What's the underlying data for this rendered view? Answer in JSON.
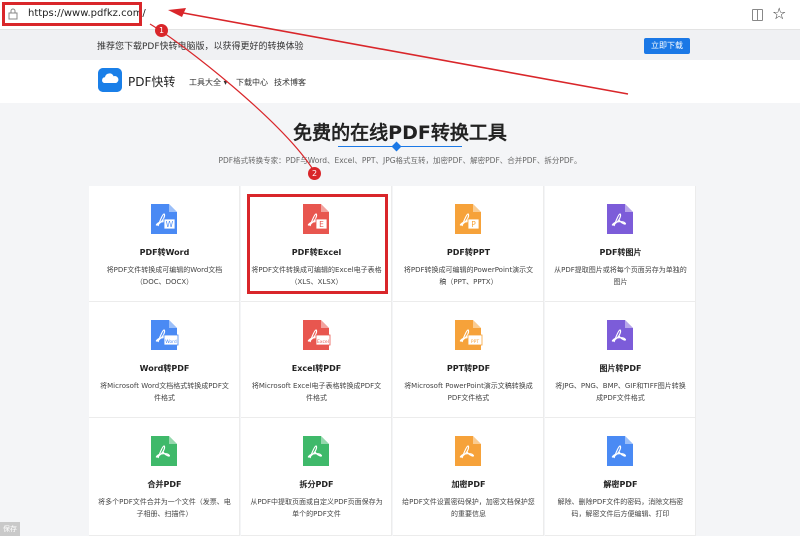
{
  "browser": {
    "url": "https://www.pdfkz.com/"
  },
  "promo": {
    "text": "推荐您下载PDF快转电脑版，以获得更好的转换体验",
    "button": "立即下载"
  },
  "nav": {
    "logo": "PDF快转",
    "items": [
      "工具大全",
      "下载中心",
      "技术博客"
    ]
  },
  "hero": {
    "title": "免费的在线PDF转换工具",
    "subtitle": "PDF格式转换专家：PDF与Word、Excel、PPT、JPG格式互转，加密PDF、解密PDF、合并PDF、拆分PDF。"
  },
  "cards": [
    {
      "title": "PDF转Word",
      "desc": "将PDF文件转换成可编辑的Word文档（DOC、DOCX）",
      "color": "#4a8af4",
      "badge": "W"
    },
    {
      "title": "PDF转Excel",
      "desc": "将PDF文件转换成可编辑的Excel电子表格（XLS、XLSX）",
      "color": "#e8564f",
      "badge": "E"
    },
    {
      "title": "PDF转PPT",
      "desc": "将PDF转换成可编辑的PowerPoint演示文稿（PPT、PPTX）",
      "color": "#f6a23a",
      "badge": "P"
    },
    {
      "title": "PDF转图片",
      "desc": "从PDF提取图片或将每个页面另存为单独的图片",
      "color": "#7c5cd9",
      "badge": ""
    },
    {
      "title": "Word转PDF",
      "desc": "将Microsoft Word文档格式转换成PDF文件格式",
      "color": "#4a8af4",
      "badge": "Word"
    },
    {
      "title": "Excel转PDF",
      "desc": "将Microsoft Excel电子表格转换成PDF文件格式",
      "color": "#e8564f",
      "badge": "Excel"
    },
    {
      "title": "PPT转PDF",
      "desc": "将Microsoft PowerPoint演示文稿转换成PDF文件格式",
      "color": "#f6a23a",
      "badge": "PPT"
    },
    {
      "title": "图片转PDF",
      "desc": "将JPG、PNG、BMP、GIF和TIFF图片转换成PDF文件格式",
      "color": "#7c5cd9",
      "badge": ""
    },
    {
      "title": "合并PDF",
      "desc": "将多个PDF文件合并为一个文件（发票、电子相册、扫描件）",
      "color": "#3fb96a",
      "badge": ""
    },
    {
      "title": "拆分PDF",
      "desc": "从PDF中提取页面或自定义PDF页面保存为单个的PDF文件",
      "color": "#3fb96a",
      "badge": ""
    },
    {
      "title": "加密PDF",
      "desc": "给PDF文件设置密码保护，加密文档保护您的重要信息",
      "color": "#f6a23a",
      "badge": ""
    },
    {
      "title": "解密PDF",
      "desc": "解除、删除PDF文件的密码，消除文档密码，解密文件后方便编辑、打印",
      "color": "#4a8af4",
      "badge": ""
    }
  ],
  "annotations": {
    "marker1": "1",
    "marker2": "2",
    "corner": "保存"
  },
  "colors": {
    "accent": "#1a78e6",
    "highlight": "#d9262a"
  }
}
